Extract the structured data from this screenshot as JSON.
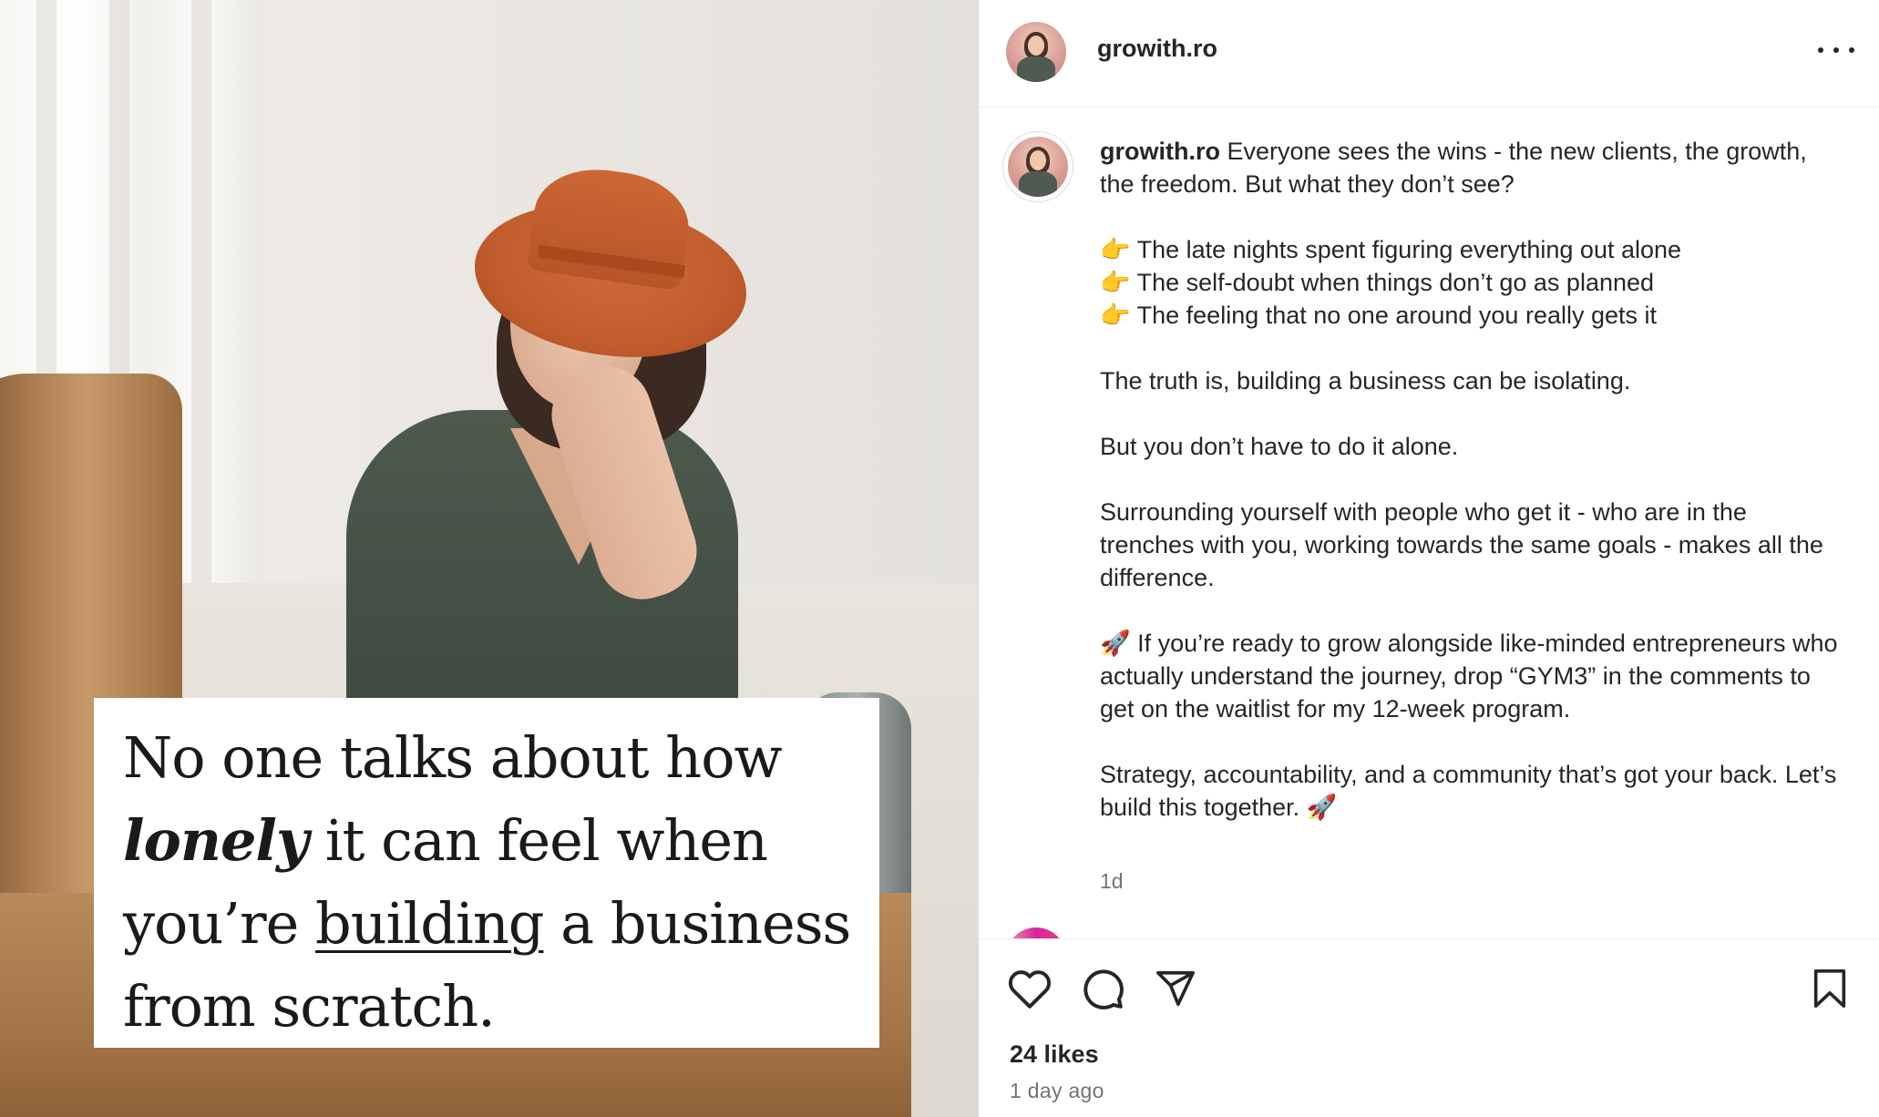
{
  "post": {
    "username": "growith.ro",
    "image_quote": {
      "line1": "No one talks about how",
      "line2_emph": "lonely",
      "line2_rest": " it can feel when",
      "line3_pre": "you’re ",
      "line3_underlined": "building",
      "line3_post": " a business",
      "line4": "from scratch."
    },
    "caption": {
      "username": "growith.ro",
      "intro": " Everyone sees the wins - the new clients, the growth, the freedom. But what they don’t see?",
      "bullets": [
        "👉 The late nights spent figuring everything out alone",
        "👉 The self-doubt when things don’t go as planned",
        "👉 The feeling that no one around you really gets it"
      ],
      "p1": "The truth is, building a business can be isolating.",
      "p2": "But you don’t have to do it alone.",
      "p3": "Surrounding yourself with people who get it - who are in the trenches with you, working towards the same goals - makes all the difference.",
      "p4": "🚀 If you’re ready to grow alongside like-minded entrepreneurs who actually understand the journey, drop “GYM3” in the comments to get on the waitlist for my 12-week program.",
      "p5": "Strategy, accountability, and a community that’s got your back. Let’s build this together. 🚀",
      "age": "1d"
    },
    "likes": "24 likes",
    "posted": "1 day ago"
  },
  "icons": {
    "more": "more-options-icon",
    "like": "heart-icon",
    "comment": "comment-icon",
    "share": "share-icon",
    "save": "bookmark-icon"
  },
  "colors": {
    "text": "#262626",
    "muted": "#737373",
    "border": "#dbdbdb",
    "hat": "#c25d2e",
    "dress": "#4e5a4e"
  }
}
